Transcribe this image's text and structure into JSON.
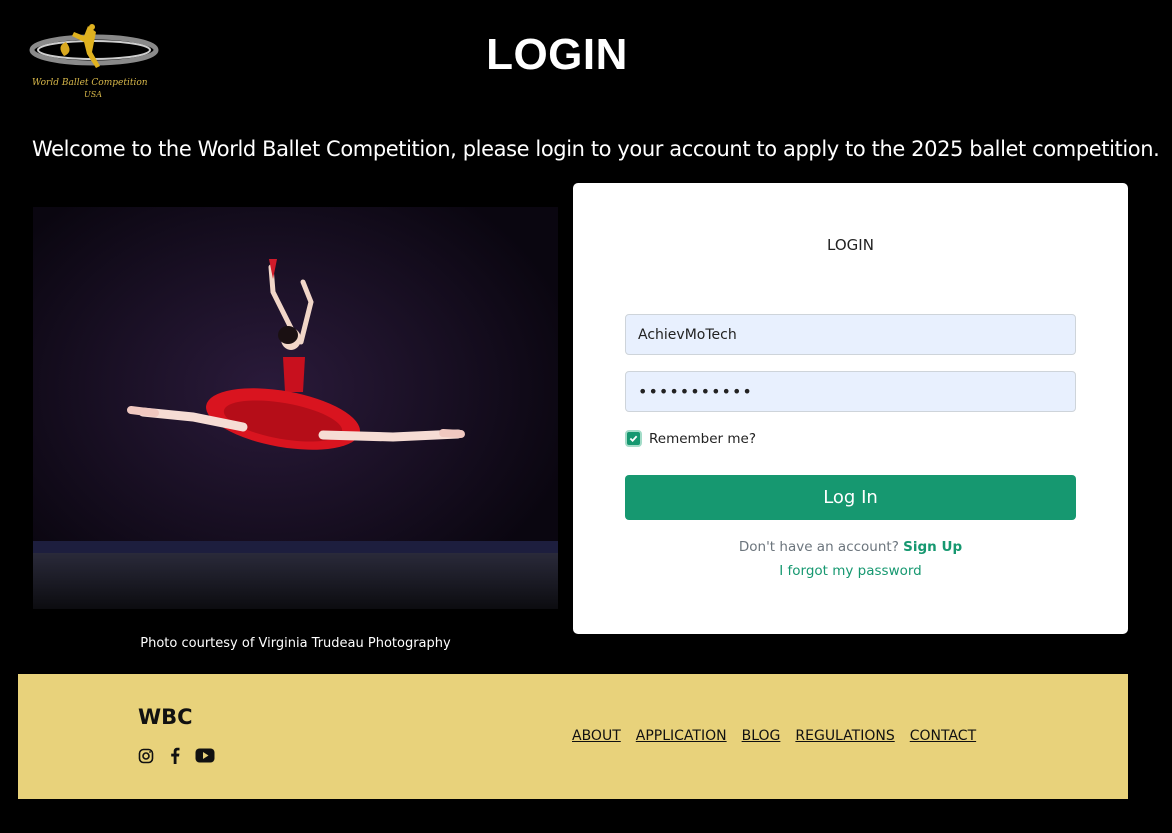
{
  "header": {
    "logo_text": "World Ballet Competition",
    "logo_subtext": "USA",
    "title": "LOGIN",
    "welcome": "Welcome to the World Ballet Competition, please login to your account to apply to the 2025 ballet competition."
  },
  "photo": {
    "caption": "Photo courtesy of Virginia Trudeau Photography"
  },
  "login_card": {
    "title": "LOGIN",
    "username_value": "AchievMoTech",
    "password_value": "•••••••••••",
    "remember_label": "Remember me?",
    "remember_checked": true,
    "login_button": "Log In",
    "no_account_text": "Don't have an account?",
    "signup_link": "Sign Up",
    "forgot_link": "I forgot my password"
  },
  "footer": {
    "brand": "WBC",
    "social_icons": [
      "instagram-icon",
      "facebook-icon",
      "youtube-icon"
    ],
    "links": [
      "ABOUT",
      "APPLICATION",
      "BLOG",
      "REGULATIONS",
      "CONTACT"
    ]
  },
  "colors": {
    "background": "#000000",
    "accent": "#169870",
    "footer_bg": "#e8d27b",
    "input_bg": "#e8f0fe"
  }
}
